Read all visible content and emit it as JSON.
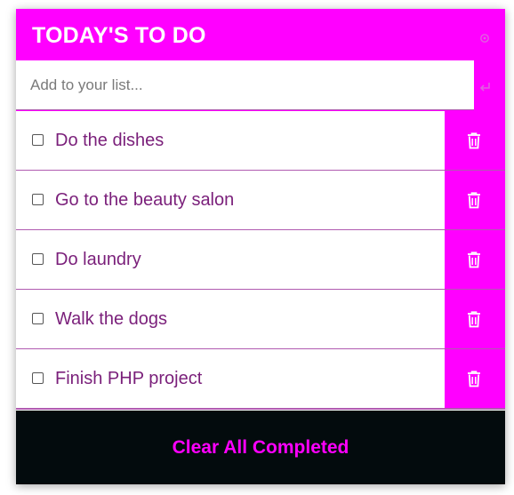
{
  "header": {
    "title": "TODAY'S TO DO",
    "settings_icon": "gear-icon"
  },
  "input": {
    "placeholder": "Add to your list...",
    "value": "",
    "submit_icon": "enter-return-icon"
  },
  "todos": [
    {
      "label": "Do the dishes",
      "checked": false
    },
    {
      "label": "Go to the beauty salon",
      "checked": false
    },
    {
      "label": "Do laundry",
      "checked": false
    },
    {
      "label": "Walk the dogs",
      "checked": false
    },
    {
      "label": "Finish PHP project",
      "checked": false
    }
  ],
  "footer": {
    "clear_label": "Clear All Completed"
  },
  "colors": {
    "accent": "#ff00ff",
    "text": "#7a1f7a",
    "footer_bg": "#030b0d",
    "divider": "#b05bb0"
  }
}
